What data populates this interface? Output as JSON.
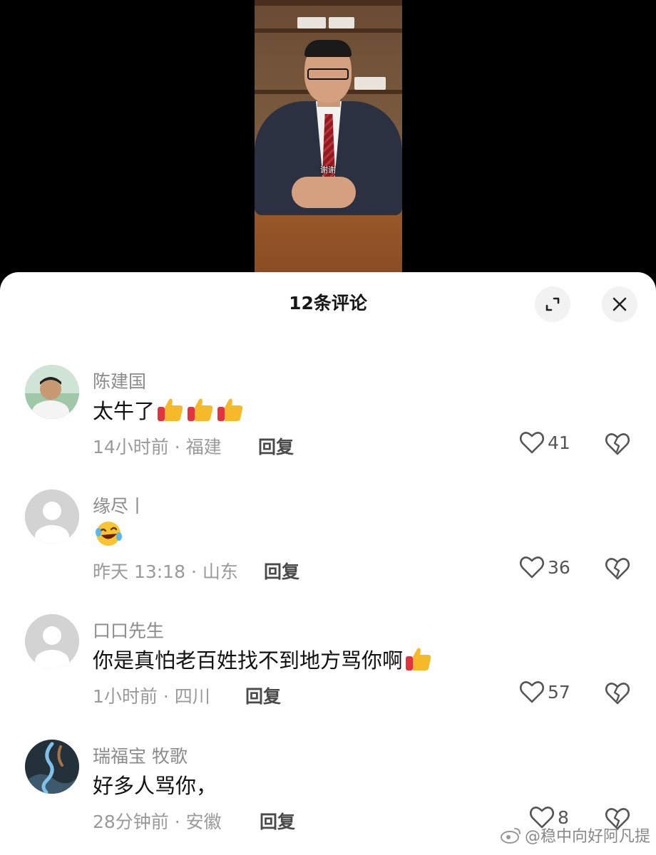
{
  "video": {
    "caption": "谢谢"
  },
  "sheet": {
    "title": "12条评论"
  },
  "comments": [
    {
      "username": "陈建国",
      "text": "太牛了",
      "emojis": [
        "thumbs-up",
        "thumbs-up",
        "thumbs-up"
      ],
      "meta": "14小时前 · 福建",
      "reply": "回复",
      "likes": "41"
    },
    {
      "username": "缘尽丨",
      "text": "",
      "emojis": [
        "laughing-crying"
      ],
      "meta": "昨天 13:18 · 山东",
      "reply": "回复",
      "likes": "36"
    },
    {
      "username": "口口先生",
      "text": "你是真怕老百姓找不到地方骂你啊",
      "emojis": [
        "thumbs-up"
      ],
      "meta": "1小时前 · 四川",
      "reply": "回复",
      "likes": "57"
    },
    {
      "username": "瑞福宝 牧歌",
      "text": "好多人骂你，",
      "emojis": [],
      "meta": "28分钟前 · 安徽",
      "reply": "回复",
      "likes": "8"
    }
  ],
  "watermark": "@稳中向好阿凡提",
  "icons": {
    "expand": "expand-icon",
    "close": "close-icon",
    "like": "heart-icon",
    "dislike": "broken-heart-icon"
  }
}
